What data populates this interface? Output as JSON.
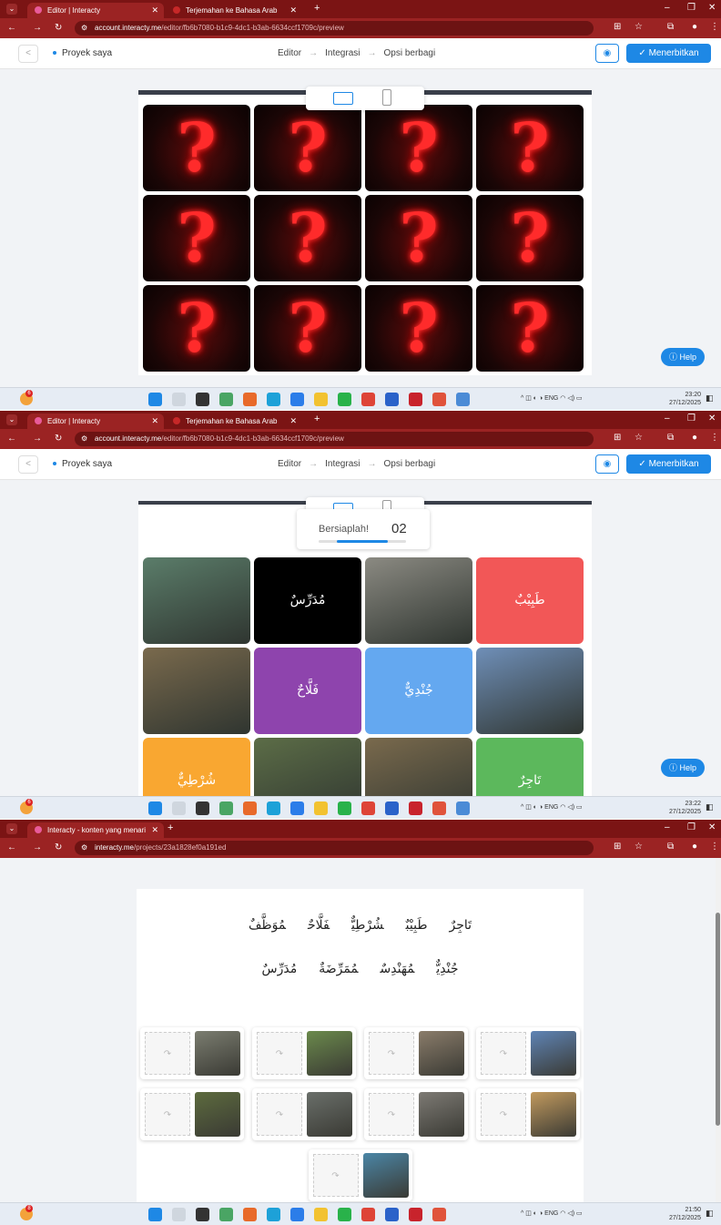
{
  "screens": [
    {
      "tabs": [
        {
          "title": "Editor | Interacty",
          "active": true
        },
        {
          "title": "Terjemahan ke Bahasa Arab",
          "active": false
        }
      ],
      "url": {
        "host": "account.interacty.me",
        "path": "/editor/fb6b7080-b1c9-4dc1-b3ab-6634ccf1709c/preview"
      },
      "clock": {
        "time": "23:20",
        "date": "27/12/2025"
      }
    },
    {
      "tabs": [
        {
          "title": "Editor | Interacty",
          "active": true
        },
        {
          "title": "Terjemahan ke Bahasa Arab",
          "active": false
        }
      ],
      "url": {
        "host": "account.interacty.me",
        "path": "/editor/fb6b7080-b1c9-4dc1-b3ab-6634ccf1709c/preview"
      },
      "clock": {
        "time": "23:22",
        "date": "27/12/2025"
      }
    },
    {
      "tabs": [
        {
          "title": "Interacty - konten yang menari",
          "active": true
        }
      ],
      "url": {
        "host": "interacty.me",
        "path": "/projects/23a1828ef0a191ed"
      },
      "clock": {
        "time": "21:50",
        "date": "27/12/2025"
      }
    }
  ],
  "editor": {
    "back": "<",
    "project": "Proyek saya",
    "steps": [
      "Editor",
      "Integrasi",
      "Opsi berbagi"
    ],
    "arrow": "→",
    "publish": "✓ Menerbitkan",
    "help": "ⓘ Help"
  },
  "memory_game": {
    "question_mark": "?",
    "countdown_label": "Bersiaplah!",
    "countdown_value": "02",
    "countdown_progress": 0.58,
    "cards": [
      {
        "kind": "photo",
        "label": ""
      },
      {
        "kind": "word",
        "label": "مُدَرِّسٌ",
        "color": "#000000"
      },
      {
        "kind": "photo",
        "label": ""
      },
      {
        "kind": "word",
        "label": "طَبِيْبٌ",
        "color": "#f25757"
      },
      {
        "kind": "photo",
        "label": ""
      },
      {
        "kind": "word",
        "label": "فَلَّاحٌ",
        "color": "#8e44ad"
      },
      {
        "kind": "word",
        "label": "جُنْدِيٌّ",
        "color": "#64a8f0"
      },
      {
        "kind": "photo",
        "label": ""
      },
      {
        "kind": "word",
        "label": "شُرْطِيٌّ",
        "color": "#f9a731"
      },
      {
        "kind": "photo",
        "label": ""
      },
      {
        "kind": "photo",
        "label": ""
      },
      {
        "kind": "word",
        "label": "تَاجِرٌ",
        "color": "#5cb85c"
      }
    ]
  },
  "matching": {
    "words_row1": [
      "تَاجِرٌ",
      "طَبِيْبٌ",
      "شُرْطِيٌّ",
      "فَلَّاحٌ",
      "مُوَظَّفٌ"
    ],
    "words_row2": [
      "جُنْدِيٌّ",
      "مُهَنْدِسٌ",
      "مُمَرِّضَةٌ",
      "مُدَرِّسٌ"
    ],
    "slot_icon": "↷",
    "images": [
      "soldier",
      "farmer",
      "engineer",
      "doctor",
      "police",
      "merchant",
      "employee",
      "nurse",
      "teacher"
    ]
  },
  "tray": {
    "lang": "ENG"
  },
  "colors": {
    "chrome": "#7b1414",
    "accent": "#1e88e5"
  }
}
